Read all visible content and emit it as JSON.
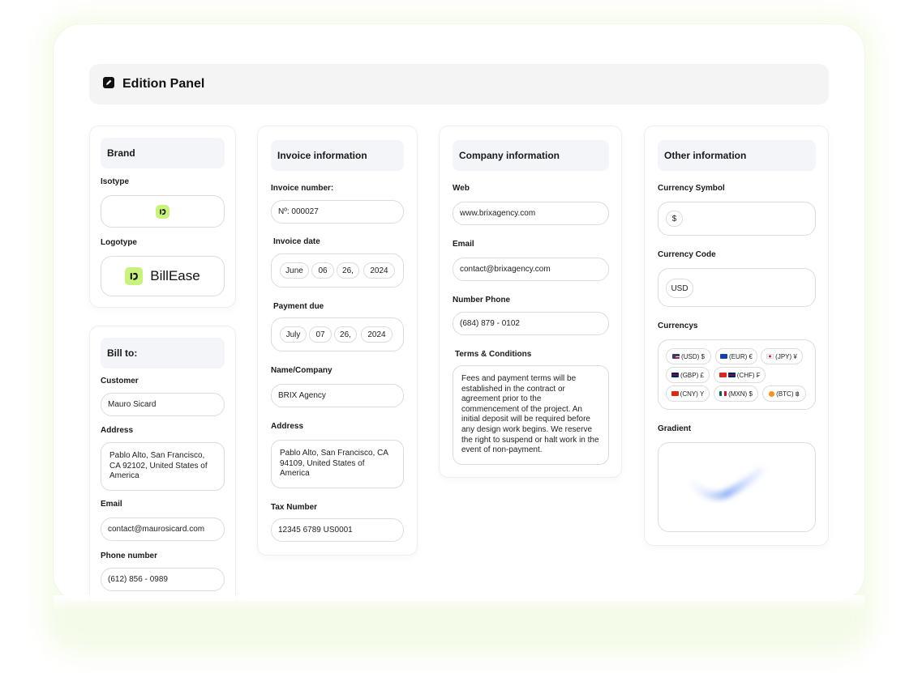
{
  "panel": {
    "title": "Edition Panel",
    "icon": "pencil-square-icon"
  },
  "brand": {
    "title": "Brand",
    "isotype_label": "Isotype",
    "logotype_label": "Logotype",
    "logo_text": "BillEase",
    "accent": "#c8f27a"
  },
  "bill_to": {
    "title": "Bill to:",
    "customer_label": "Customer",
    "customer": "Mauro Sicard",
    "address_label": "Address",
    "address": "Pablo Alto, San Francisco, CA 92102, United States of America",
    "email_label": "Email",
    "email": "contact@maurosicard.com",
    "phone_label": "Phone number",
    "phone": "(612) 856 - 0989"
  },
  "invoice": {
    "title": "Invoice information",
    "number_label": "Invoice number:",
    "number": "Nº: 000027",
    "date_label": "Invoice date",
    "date": {
      "month": "June",
      "day": "06",
      "sep": "26,",
      "year": "2024"
    },
    "due_label": "Payment due",
    "due": {
      "month": "July",
      "day": "07",
      "sep": "26,",
      "year": "2024"
    },
    "name_label": "Name/Company",
    "name": "BRIX Agency",
    "address_label": "Address",
    "address": "Pablo Alto, San Francisco, CA 94109, United States of America",
    "tax_label": "Tax Number",
    "tax": "12345 6789 US0001"
  },
  "company": {
    "title": "Company information",
    "web_label": "Web",
    "web": "www.brixagency.com",
    "email_label": "Email",
    "email": "contact@brixagency.com",
    "phone_label": "Number Phone",
    "phone": "(684) 879 - 0102",
    "terms_label": "Terms & Conditions",
    "terms": "Fees and payment terms will be established in the contract or agreement prior to the commencement of the project. An initial deposit will be required before any design work begins. We reserve the right to suspend or halt work in the event of non-payment."
  },
  "other": {
    "title": "Other information",
    "symbol_label": "Currency Symbol",
    "symbol": "$",
    "code_label": "Currency Code",
    "code": "USD",
    "currencies_label": "Currencys",
    "currencies": [
      {
        "label": "(USD) $",
        "flag": "us-flag-icon"
      },
      {
        "label": "(EUR) €",
        "flag": "eu-flag-icon"
      },
      {
        "label": "(JPY) ¥",
        "flag": "jp-flag-icon"
      },
      {
        "label": "(GBP) £",
        "flag": "gb-flag-icon"
      },
      {
        "label": "(CHF) ₣",
        "flag": "ch-flag-icon"
      },
      {
        "label": "(CNY) Y",
        "flag": "cn-flag-icon"
      },
      {
        "label": "(MXN) $",
        "flag": "mx-flag-icon"
      },
      {
        "label": "(BTC) ฿",
        "flag": "btc-icon"
      }
    ],
    "gradient_label": "Gradient"
  }
}
